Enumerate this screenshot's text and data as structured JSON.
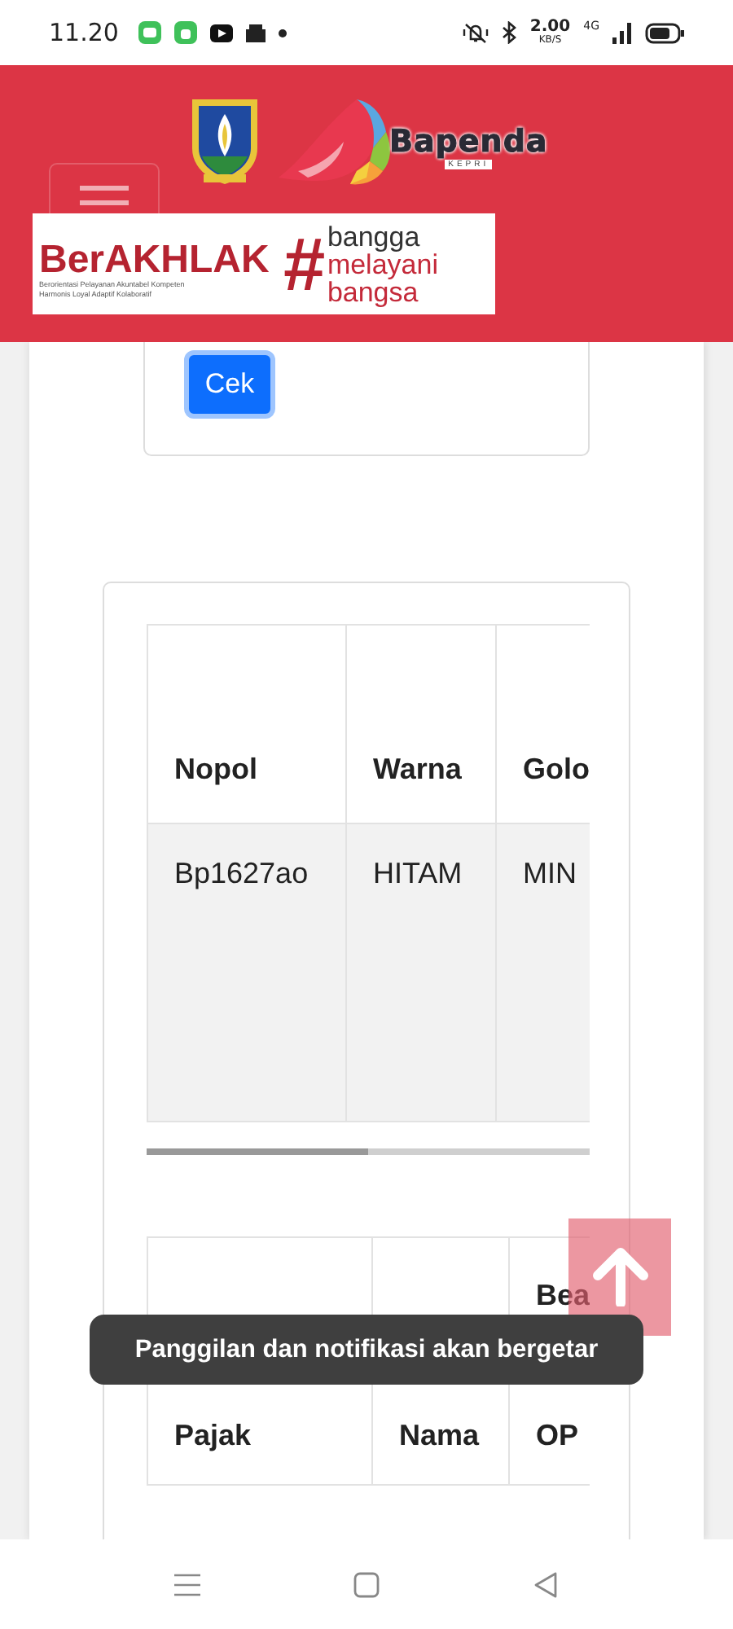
{
  "status_bar": {
    "time": "11.20",
    "data_rate": "2.00",
    "data_unit": "KB/S",
    "network": "4G"
  },
  "header": {
    "logo_text": "Bapenda",
    "logo_subtext": "KEPRI",
    "banner": {
      "title": "BerAKHLAK",
      "tagline": [
        "Berorientasi Pelayanan Akuntabel Kompeten",
        "Harmonis Loyal Adaptif Kolaboratif"
      ],
      "hash": "#",
      "slogan": [
        "bangga",
        "melayani",
        "bangsa"
      ]
    }
  },
  "check_button": "Cek",
  "tables": [
    {
      "columns": [
        "Nopol",
        "Warna",
        "Golo"
      ],
      "rows": [
        [
          "Bp1627ao",
          "HITAM",
          "MIN"
        ]
      ]
    },
    {
      "columns": [
        {
          "bottom": "Pajak"
        },
        {
          "bottom": "Nama"
        },
        {
          "top": "Bea",
          "bottom": "OP"
        }
      ]
    }
  ],
  "toast": "Panggilan dan notifikasi akan bergetar"
}
